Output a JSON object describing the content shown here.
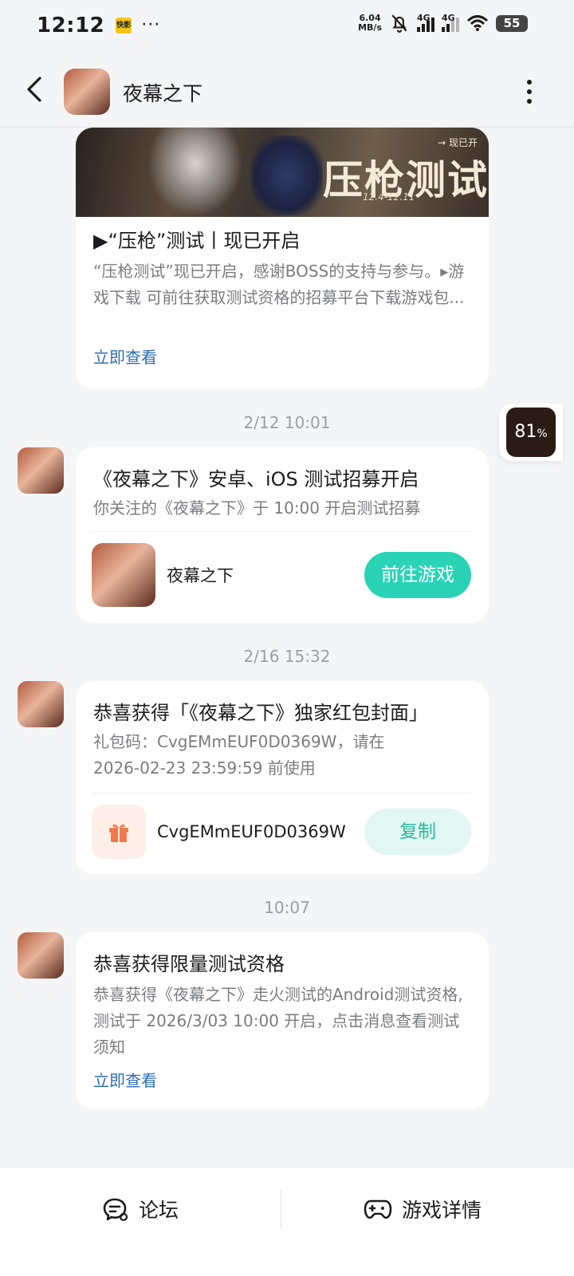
{
  "status_bar": {
    "time": "12:12",
    "notif_icon_text": "快影",
    "more_indicator": "···",
    "net_speed_value": "6.04",
    "net_speed_unit": "MB/s",
    "signal1_label": "4G",
    "signal2_label": "4G",
    "battery": "55"
  },
  "header": {
    "title": "夜幕之下"
  },
  "messages": [
    {
      "title": "▶“压枪”测试丨现已开启",
      "desc": "“压枪测试”现已开启，感谢BOSS的支持与参与。▸游戏下载 可前往获取测试资格的招募平台下载游戏包...",
      "link": "立即查看",
      "banner_text": "压枪测试",
      "banner_sub": "→ 现已开",
      "banner_date": "12.4-12.11"
    },
    {
      "timestamp": "2/12  10:01",
      "title": "《夜幕之下》安卓、iOS 测试招募开启",
      "desc": "你关注的《夜幕之下》于 10:00 开启测试招募",
      "game_name": "夜幕之下",
      "button": "前往游戏"
    },
    {
      "timestamp": "2/16  15:32",
      "title": "恭喜获得「《夜幕之下》独家红包封面」",
      "desc": "礼包码：CvgEMmEUF0D0369W，请在 2026-02-23 23:59:59 前使用",
      "code": "CvgEMmEUF0D0369W",
      "button": "复制"
    },
    {
      "timestamp": "10:07",
      "title": "恭喜获得限量测试资格",
      "desc": "恭喜获得《夜幕之下》走火测试的Android测试资格,测试于 2026/3/03 10:00 开启，点击消息查看测试须知",
      "link": "立即查看"
    }
  ],
  "float_badge": {
    "value": "81",
    "unit": "%"
  },
  "bottom_bar": {
    "tab1": "论坛",
    "tab2": "游戏详情"
  },
  "colors": {
    "accent": "#2ad3b6",
    "link": "#2f6db3",
    "background": "#f4f5f7"
  }
}
